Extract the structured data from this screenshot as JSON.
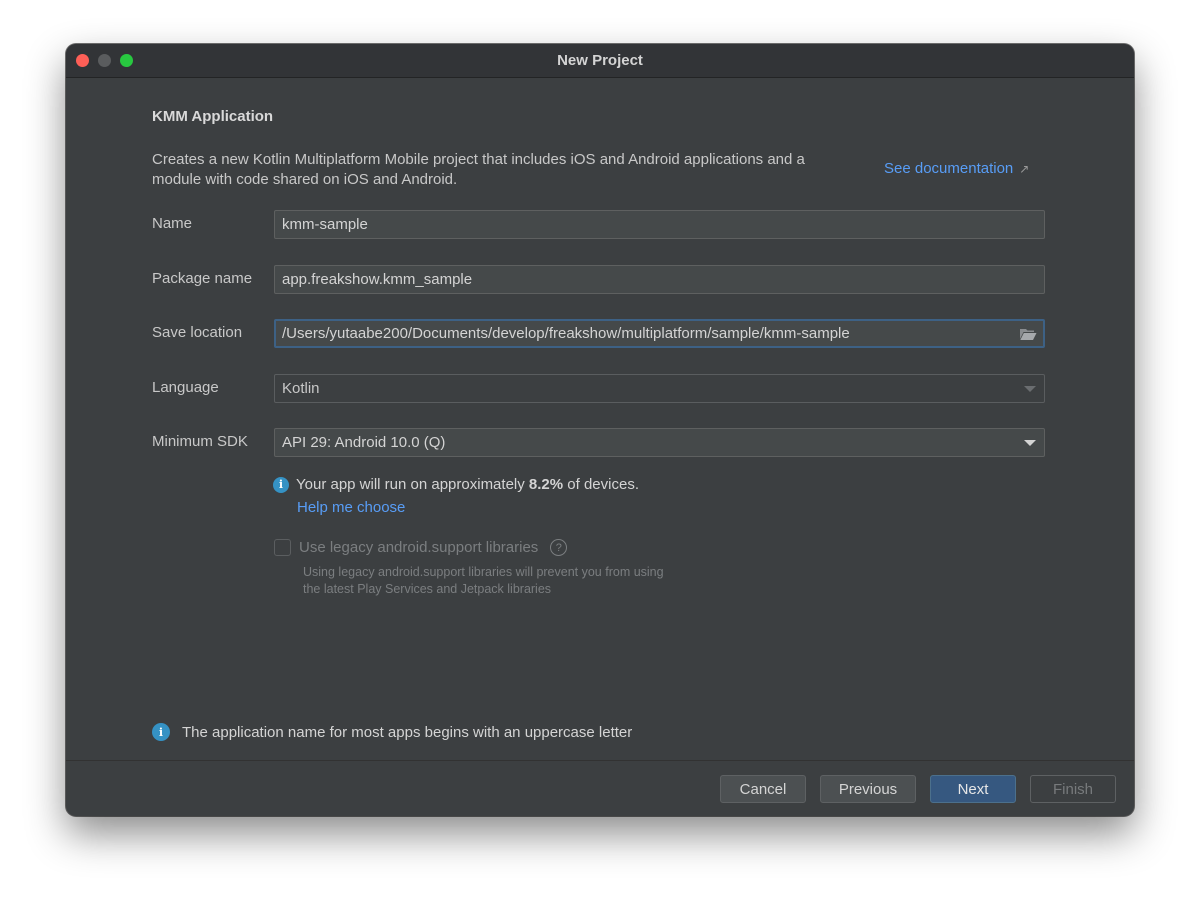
{
  "window": {
    "title": "New Project"
  },
  "form": {
    "heading": "KMM Application",
    "description": "Creates a new Kotlin Multiplatform Mobile project that includes iOS and Android applications and a module with code shared on iOS and Android.",
    "doc_link": "See documentation",
    "name": {
      "label": "Name",
      "value": "kmm-sample"
    },
    "package": {
      "label": "Package name",
      "value": "app.freakshow.kmm_sample"
    },
    "save_location": {
      "label": "Save location",
      "value": "/Users/yutaabe200/Documents/develop/freakshow/multiplatform/sample/kmm-sample"
    },
    "language": {
      "label": "Language",
      "value": "Kotlin"
    },
    "min_sdk": {
      "label": "Minimum SDK",
      "value": "API 29: Android 10.0 (Q)"
    },
    "info_prefix": "Your app will run on approximately ",
    "info_percent": "8.2%",
    "info_suffix": " of devices.",
    "help_link": "Help me choose",
    "legacy_label": "Use legacy android.support libraries",
    "legacy_checked": false,
    "legacy_note_1": "Using legacy android.support libraries will prevent you from using",
    "legacy_note_2": "the latest Play Services and Jetpack libraries"
  },
  "footer_hint": "The application name for most apps begins with an uppercase letter",
  "buttons": {
    "cancel": "Cancel",
    "previous": "Previous",
    "next": "Next",
    "finish": "Finish"
  },
  "colors": {
    "background": "#3c3f41",
    "link": "#589df6",
    "primary_button": "#365880",
    "info_icon": "#3592c4"
  }
}
